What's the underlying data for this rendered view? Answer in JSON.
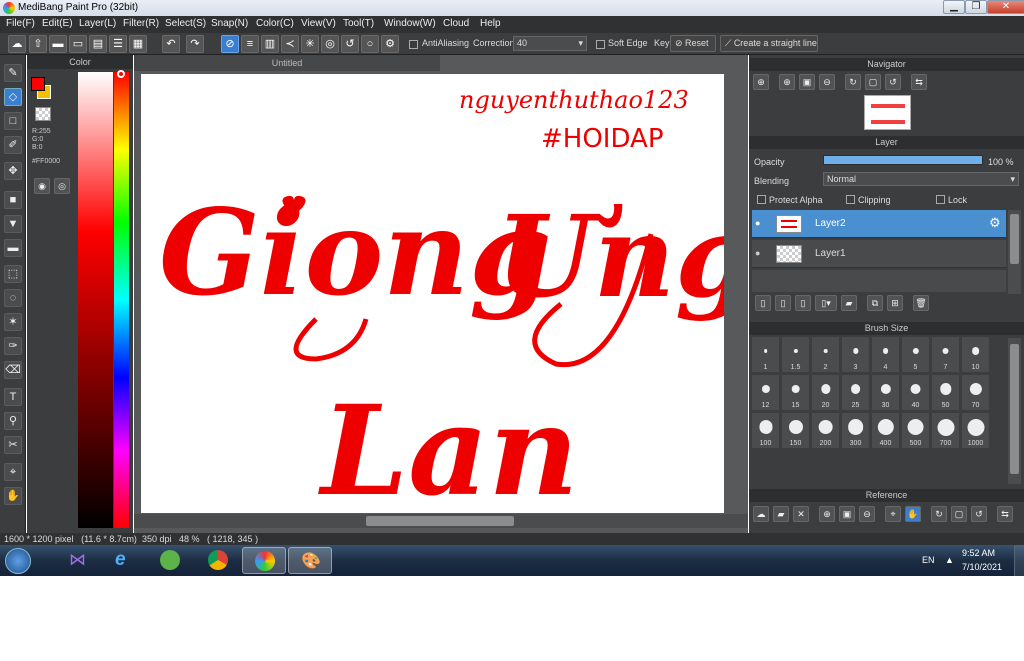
{
  "window": {
    "title": "MediBang Paint Pro (32bit)",
    "min": "▁",
    "max": "❐",
    "close": "✕"
  },
  "menu": [
    "File(F)",
    "Edit(E)",
    "Layer(L)",
    "Filter(R)",
    "Select(S)",
    "Snap(N)",
    "Color(C)",
    "View(V)",
    "Tool(T)",
    "Window(W)",
    "Cloud",
    "Help"
  ],
  "toolbar": {
    "antialiasing": "AntiAliasing",
    "correction_label": "Correction",
    "correction_value": "40",
    "soft_edge": "Soft Edge",
    "key": "Key",
    "reset": "Reset",
    "straight_line": "Create a straight line"
  },
  "color_panel": {
    "title": "Color",
    "r": "R:255",
    "g": "G:0",
    "b": "B:0",
    "hex": "#FF0000",
    "main_color": "#ff0000",
    "sub_color": "#f5c000"
  },
  "document": {
    "tab": "Untitled"
  },
  "canvas_text": {
    "line1": "nguyenthuthao123",
    "line2": "#HOIDAP",
    "word1": "Giong",
    "word2": "Ưng",
    "word3": "Lan"
  },
  "status": {
    "size": "1600 * 1200 pixel",
    "cm": "(11.6 * 8.7cm)",
    "dpi": "350 dpi",
    "zoom": "48 %",
    "coords": "( 1218, 345 )"
  },
  "navigator": {
    "title": "Navigator"
  },
  "layer_panel": {
    "title": "Layer",
    "opacity_label": "Opacity",
    "opacity_value": "100 %",
    "opacity_fraction": 1.0,
    "blending_label": "Blending",
    "blending_value": "Normal",
    "protect_alpha": "Protect Alpha",
    "clipping": "Clipping",
    "lock": "Lock",
    "layers": [
      {
        "name": "Layer2"
      },
      {
        "name": "Layer1"
      }
    ]
  },
  "brush_size": {
    "title": "Brush Size",
    "sizes": [
      "1",
      "1.5",
      "2",
      "3",
      "4",
      "5",
      "7",
      "10",
      "12",
      "15",
      "20",
      "25",
      "30",
      "40",
      "50",
      "70",
      "100",
      "150",
      "200",
      "300",
      "400",
      "500",
      "700",
      "1000"
    ]
  },
  "reference": {
    "title": "Reference"
  },
  "taskbar": {
    "lang": "EN",
    "time": "9:52 AM",
    "date": "7/10/2021"
  }
}
